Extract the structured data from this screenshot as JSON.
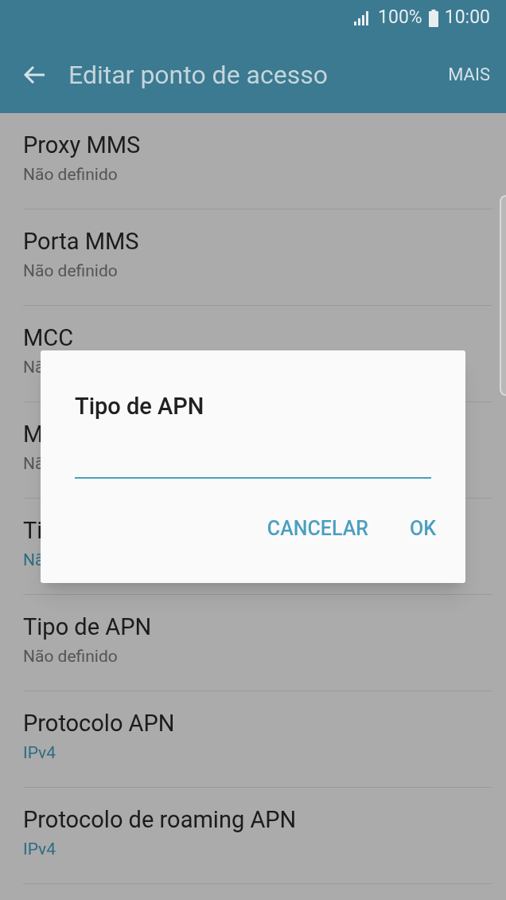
{
  "status_bar": {
    "battery": "100%",
    "time": "10:00"
  },
  "app_bar": {
    "title": "Editar ponto de acesso",
    "action": "MAIS"
  },
  "settings": [
    {
      "title": "Proxy MMS",
      "value": "Não definido",
      "defined": false
    },
    {
      "title": "Porta MMS",
      "value": "Não definido",
      "defined": false
    },
    {
      "title": "MCC",
      "value": "Nã",
      "defined": false
    },
    {
      "title": "M",
      "value": "Nã",
      "defined": false
    },
    {
      "title": "Ti",
      "value": "Nã",
      "defined": true
    },
    {
      "title": "Tipo de APN",
      "value": "Não definido",
      "defined": false
    },
    {
      "title": "Protocolo APN",
      "value": "IPv4",
      "defined": true
    },
    {
      "title": "Protocolo de roaming APN",
      "value": "IPv4",
      "defined": true
    }
  ],
  "dialog": {
    "title": "Tipo de APN",
    "input_focused": true,
    "buttons": [
      "CANCELAR",
      "OK"
    ]
  }
}
